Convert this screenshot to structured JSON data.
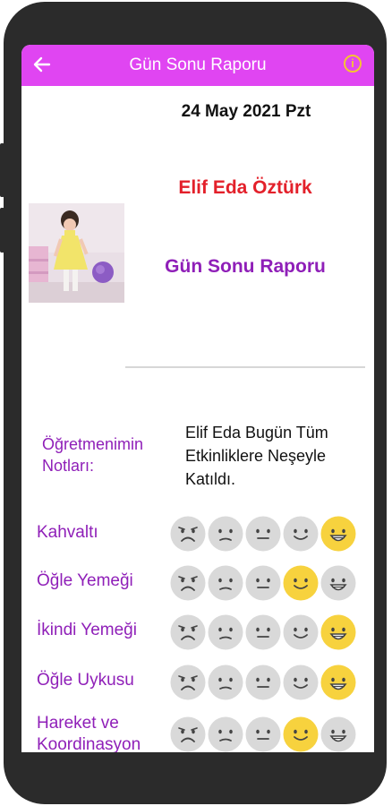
{
  "appbar": {
    "title": "Gün Sonu Raporu",
    "back_icon": "arrow-left-icon",
    "info_icon": "info-icon"
  },
  "date": "24 May 2021 Pzt",
  "student": {
    "name": "Elif Eda Öztürk",
    "photo": "child-photo"
  },
  "report_title": "Gün Sonu Raporu",
  "notes": {
    "label": "Öğretmenimin Notları:",
    "text": "Elif Eda Bugün Tüm Etkinliklere Neşeyle Katıldı."
  },
  "face_scale": [
    "very-sad-face-icon",
    "sad-face-icon",
    "neutral-face-icon",
    "smile-face-icon",
    "happy-face-icon"
  ],
  "colors": {
    "appbar": "#e045f2",
    "accent": "#8f1fb8",
    "name": "#e3202a",
    "face_active": "#f7d23e",
    "face_inactive": "#d9d9d9"
  },
  "ratings": [
    {
      "label": "Kahvaltı",
      "selected": 5
    },
    {
      "label": "Öğle Yemeği",
      "selected": 4
    },
    {
      "label": "İkindi Yemeği",
      "selected": 5
    },
    {
      "label": "Öğle Uykusu",
      "selected": 5
    },
    {
      "label": "Hareket ve Koordinasyon",
      "selected": 4
    }
  ]
}
